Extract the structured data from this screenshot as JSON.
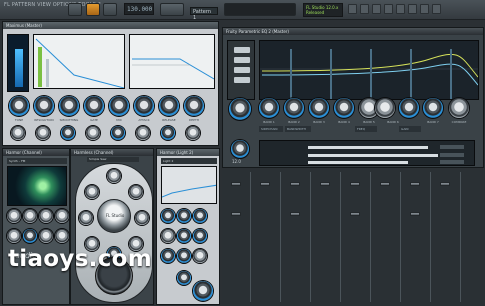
{
  "toolbar": {
    "title": "FL PATTERN  VIEW OPTIONS  TOOLS ?",
    "tempo": "130.000",
    "pattern": "Pattern 1",
    "hint": "FL Studio 12.0.x Released"
  },
  "panels": {
    "top_left": {
      "title": "Maximus (Master)",
      "preset": "Master Default Preset"
    },
    "top_right": {
      "title": "Fruity Parametric EQ 2 (Master)"
    },
    "bottom_left": {
      "title": "Harmor (Channel)",
      "preset": "Synth – FM"
    },
    "bottom_mid": {
      "title": "Harmless (Channel)",
      "preset": "Simple Saw"
    },
    "bottom_right": {
      "title": "Harmor (Light 2)",
      "preset": "Light 2"
    }
  },
  "labels": {
    "tl_knobs": [
      "TONE",
      "RESOLUTION",
      "SMOOTHING",
      "GATE",
      "MIX",
      "ATTACK",
      "RELEASE",
      "DEPTH",
      "SPEED"
    ],
    "tr_knobs": [
      "BAND 1",
      "BAND 2",
      "BAND 3",
      "BAND 4",
      "BAND 5",
      "BAND 6",
      "BAND 7",
      "COMPARE"
    ],
    "tr_hints": [
      "SIDECHAIN",
      "BANDWIDTH",
      "FREQ",
      "GAIN"
    ],
    "mid_buttons": [
      "PRE-DELAY",
      "TIME",
      "DIFFUSE",
      "SIZE",
      "DECAY",
      "MIX",
      "DRY",
      "WET"
    ],
    "tr_readout": "12.0",
    "brand": "audio",
    "mid_title": "FL Studio"
  },
  "watermark": "tiaoys.com",
  "colors": {
    "accent": "#2a8fd6",
    "panel": "#c7cbcf",
    "bg": "#2b3034",
    "orange": "#e49b2f"
  }
}
